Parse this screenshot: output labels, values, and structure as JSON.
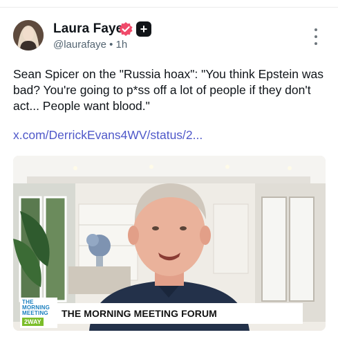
{
  "post": {
    "author_name": "Laura Faye",
    "handle": "@laurafaye",
    "separator": "•",
    "time": "1h",
    "plus_badge": "+",
    "verified_icon": "verified-badge-icon",
    "more_icon": "more-vertical-icon",
    "text": "Sean Spicer on the \"Russia hoax\": \"You think Epstein was bad? You're going to p*ss off a lot of people if they don't act... People want blood.\"",
    "link": "x.com/DerrickEvans4WV/status/2..."
  },
  "video": {
    "logo_lines": [
      "THE",
      "MORNING",
      "MEETING"
    ],
    "logo_brand": "2WAY",
    "lower_third_title": "THE MORNING MEETING FORUM"
  },
  "colors": {
    "link": "#4f58c9",
    "verify": "#f04a6a",
    "secondary_text": "#536471"
  }
}
